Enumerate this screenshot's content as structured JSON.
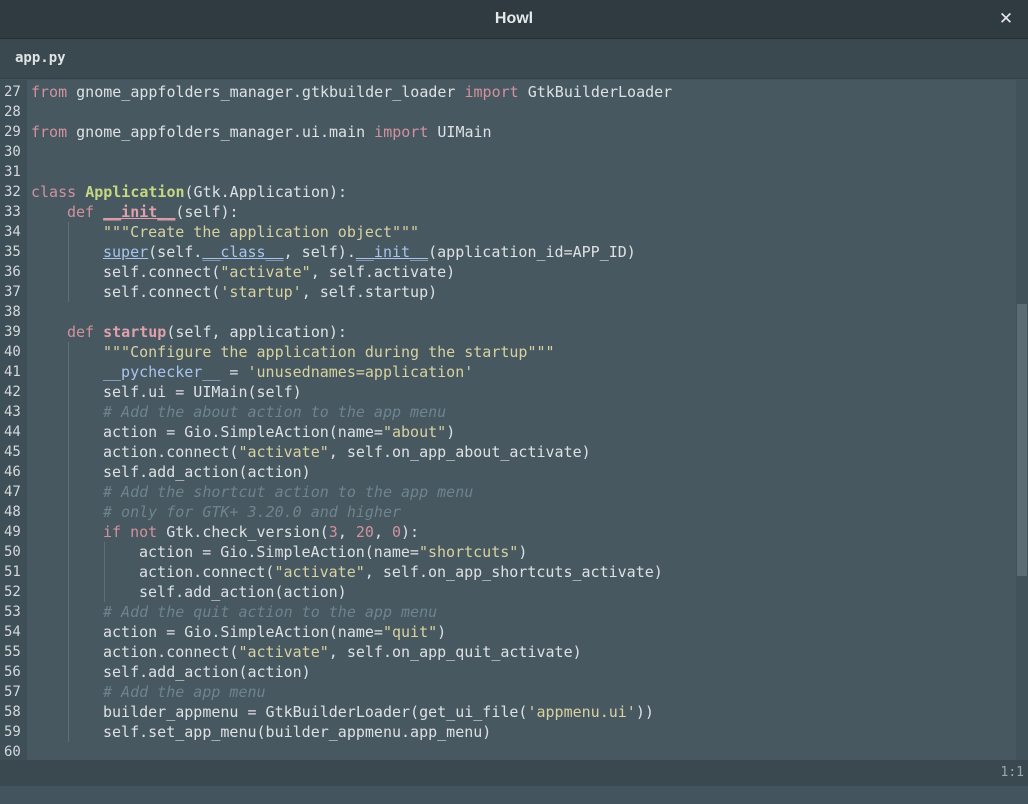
{
  "window": {
    "title": "Howl",
    "close_label": "✕"
  },
  "tab": {
    "label": "app.py"
  },
  "status": {
    "cursor_position": "1:1"
  },
  "scroll": {
    "visible_start_fraction": 0.33,
    "visible_end_fraction": 0.73
  },
  "colors": {
    "keyword": "#d0929e",
    "class_name": "#c6d884",
    "function_name": "#e0a0ab",
    "builtin": "#a9c4ea",
    "string": "#d8d2a0",
    "comment": "#6f848e",
    "text": "#dde1e3",
    "background": "#475861"
  },
  "code": [
    {
      "n": "27",
      "indent": 0,
      "t": [
        [
          "kw",
          "from"
        ],
        [
          "txt",
          " gnome_appfolders_manager.gtkbuilder_loader "
        ],
        [
          "kw",
          "import"
        ],
        [
          "txt",
          " GtkBuilderLoader"
        ]
      ]
    },
    {
      "n": "28",
      "indent": 0,
      "t": []
    },
    {
      "n": "29",
      "indent": 0,
      "t": [
        [
          "kw",
          "from"
        ],
        [
          "txt",
          " gnome_appfolders_manager.ui.main "
        ],
        [
          "kw",
          "import"
        ],
        [
          "txt",
          " UIMain"
        ]
      ]
    },
    {
      "n": "30",
      "indent": 0,
      "t": []
    },
    {
      "n": "31",
      "indent": 0,
      "t": []
    },
    {
      "n": "32",
      "indent": 0,
      "t": [
        [
          "kw",
          "class"
        ],
        [
          "txt",
          " "
        ],
        [
          "cls",
          "Application"
        ],
        [
          "txt",
          "(Gtk.Application):"
        ]
      ]
    },
    {
      "n": "33",
      "indent": 1,
      "t": [
        [
          "kw",
          "def"
        ],
        [
          "txt",
          " "
        ],
        [
          "dun",
          "__init__"
        ],
        [
          "txt",
          "(self):"
        ]
      ]
    },
    {
      "n": "34",
      "indent": 2,
      "t": [
        [
          "str",
          "\"\"\"Create the application object\"\"\""
        ]
      ]
    },
    {
      "n": "35",
      "indent": 2,
      "t": [
        [
          "bi",
          "super"
        ],
        [
          "txt",
          "(self."
        ],
        [
          "bi",
          "__class__"
        ],
        [
          "txt",
          ", self)."
        ],
        [
          "bi",
          "__init__"
        ],
        [
          "txt",
          "(application_id=APP_ID)"
        ]
      ]
    },
    {
      "n": "36",
      "indent": 2,
      "t": [
        [
          "txt",
          "self.connect("
        ],
        [
          "str",
          "\"activate\""
        ],
        [
          "txt",
          ", self.activate)"
        ]
      ]
    },
    {
      "n": "37",
      "indent": 2,
      "t": [
        [
          "txt",
          "self.connect("
        ],
        [
          "str",
          "'startup'"
        ],
        [
          "txt",
          ", self.startup)"
        ]
      ]
    },
    {
      "n": "38",
      "indent": 0,
      "t": []
    },
    {
      "n": "39",
      "indent": 1,
      "t": [
        [
          "kw",
          "def"
        ],
        [
          "txt",
          " "
        ],
        [
          "fn",
          "startup"
        ],
        [
          "txt",
          "(self, application):"
        ]
      ]
    },
    {
      "n": "40",
      "indent": 2,
      "t": [
        [
          "str",
          "\"\"\"Configure the application during the startup\"\"\""
        ]
      ]
    },
    {
      "n": "41",
      "indent": 2,
      "t": [
        [
          "pyc",
          "__pychecker__"
        ],
        [
          "txt",
          " = "
        ],
        [
          "str",
          "'unusednames=application'"
        ]
      ]
    },
    {
      "n": "42",
      "indent": 2,
      "t": [
        [
          "txt",
          "self.ui = UIMain(self)"
        ]
      ]
    },
    {
      "n": "43",
      "indent": 2,
      "t": [
        [
          "cm",
          "# Add the about action to the app menu"
        ]
      ]
    },
    {
      "n": "44",
      "indent": 2,
      "t": [
        [
          "txt",
          "action = Gio.SimpleAction(name="
        ],
        [
          "str",
          "\"about\""
        ],
        [
          "txt",
          ")"
        ]
      ]
    },
    {
      "n": "45",
      "indent": 2,
      "t": [
        [
          "txt",
          "action.connect("
        ],
        [
          "str",
          "\"activate\""
        ],
        [
          "txt",
          ", self.on_app_about_activate)"
        ]
      ]
    },
    {
      "n": "46",
      "indent": 2,
      "t": [
        [
          "txt",
          "self.add_action(action)"
        ]
      ]
    },
    {
      "n": "47",
      "indent": 2,
      "t": [
        [
          "cm",
          "# Add the shortcut action to the app menu"
        ]
      ]
    },
    {
      "n": "48",
      "indent": 2,
      "t": [
        [
          "cm",
          "# only for GTK+ 3.20.0 and higher"
        ]
      ]
    },
    {
      "n": "49",
      "indent": 2,
      "t": [
        [
          "kw",
          "if not"
        ],
        [
          "txt",
          " Gtk.check_version("
        ],
        [
          "num",
          "3"
        ],
        [
          "txt",
          ", "
        ],
        [
          "num",
          "20"
        ],
        [
          "txt",
          ", "
        ],
        [
          "num",
          "0"
        ],
        [
          "txt",
          "):"
        ]
      ]
    },
    {
      "n": "50",
      "indent": 3,
      "t": [
        [
          "txt",
          "action = Gio.SimpleAction(name="
        ],
        [
          "str",
          "\"shortcuts\""
        ],
        [
          "txt",
          ")"
        ]
      ]
    },
    {
      "n": "51",
      "indent": 3,
      "t": [
        [
          "txt",
          "action.connect("
        ],
        [
          "str",
          "\"activate\""
        ],
        [
          "txt",
          ", self.on_app_shortcuts_activate)"
        ]
      ]
    },
    {
      "n": "52",
      "indent": 3,
      "t": [
        [
          "txt",
          "self.add_action(action)"
        ]
      ]
    },
    {
      "n": "53",
      "indent": 2,
      "t": [
        [
          "cm",
          "# Add the quit action to the app menu"
        ]
      ]
    },
    {
      "n": "54",
      "indent": 2,
      "t": [
        [
          "txt",
          "action = Gio.SimpleAction(name="
        ],
        [
          "str",
          "\"quit\""
        ],
        [
          "txt",
          ")"
        ]
      ]
    },
    {
      "n": "55",
      "indent": 2,
      "t": [
        [
          "txt",
          "action.connect("
        ],
        [
          "str",
          "\"activate\""
        ],
        [
          "txt",
          ", self.on_app_quit_activate)"
        ]
      ]
    },
    {
      "n": "56",
      "indent": 2,
      "t": [
        [
          "txt",
          "self.add_action(action)"
        ]
      ]
    },
    {
      "n": "57",
      "indent": 2,
      "t": [
        [
          "cm",
          "# Add the app menu"
        ]
      ]
    },
    {
      "n": "58",
      "indent": 2,
      "t": [
        [
          "txt",
          "builder_appmenu = GtkBuilderLoader(get_ui_file("
        ],
        [
          "str",
          "'appmenu.ui'"
        ],
        [
          "txt",
          "))"
        ]
      ]
    },
    {
      "n": "59",
      "indent": 2,
      "t": [
        [
          "txt",
          "self.set_app_menu(builder_appmenu.app_menu)"
        ]
      ]
    },
    {
      "n": "60",
      "indent": 0,
      "t": []
    }
  ]
}
